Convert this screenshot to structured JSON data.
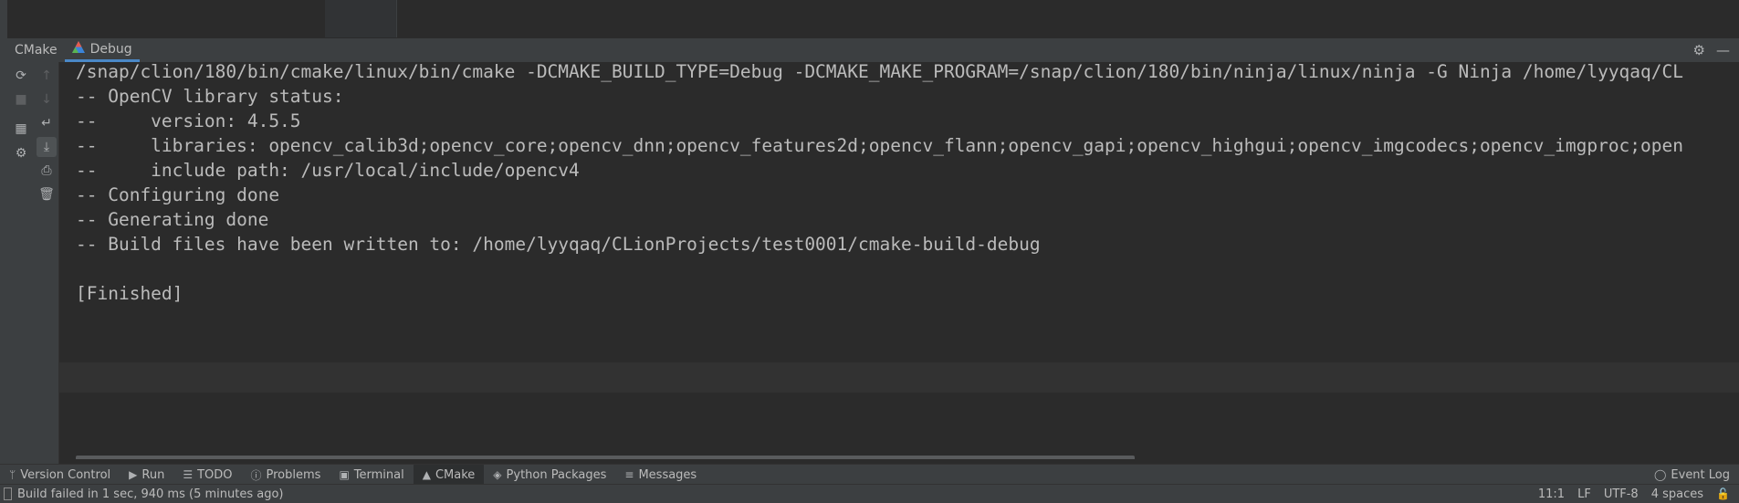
{
  "tool_window": {
    "tabs": [
      {
        "label": "CMake"
      },
      {
        "label": "Debug"
      }
    ],
    "actions": {
      "settings_icon": "gear-icon",
      "hide_icon": "minimize-icon"
    }
  },
  "console": {
    "lines": [
      "/snap/clion/180/bin/cmake/linux/bin/cmake -DCMAKE_BUILD_TYPE=Debug -DCMAKE_MAKE_PROGRAM=/snap/clion/180/bin/ninja/linux/ninja -G Ninja /home/lyyqaq/CL",
      "-- OpenCV library status:",
      "--     version: 4.5.5",
      "--     libraries: opencv_calib3d;opencv_core;opencv_dnn;opencv_features2d;opencv_flann;opencv_gapi;opencv_highgui;opencv_imgcodecs;opencv_imgproc;open",
      "--     include path: /usr/local/include/opencv4",
      "-- Configuring done",
      "-- Generating done",
      "-- Build files have been written to: /home/lyyqaq/CLionProjects/test0001/cmake-build-debug",
      "",
      "[Finished]"
    ]
  },
  "bottom_bar": {
    "items": [
      {
        "label": "Version Control",
        "icon": "branch-icon"
      },
      {
        "label": "Run",
        "icon": "play-icon"
      },
      {
        "label": "TODO",
        "icon": "list-icon"
      },
      {
        "label": "Problems",
        "icon": "info-icon"
      },
      {
        "label": "Terminal",
        "icon": "terminal-icon"
      },
      {
        "label": "CMake",
        "icon": "cmake-icon"
      },
      {
        "label": "Python Packages",
        "icon": "layers-icon"
      },
      {
        "label": "Messages",
        "icon": "messages-icon"
      }
    ],
    "event_log": "Event Log"
  },
  "status_bar": {
    "message": "Build failed in 1 sec, 940 ms (5 minutes ago)",
    "position": "11:1",
    "line_separator": "LF",
    "encoding": "UTF-8",
    "indent": "4 spaces"
  },
  "colors": {
    "background": "#2b2b2b",
    "panel": "#3c3f41",
    "accent": "#4a88c7",
    "text": "#bbbbbb"
  }
}
